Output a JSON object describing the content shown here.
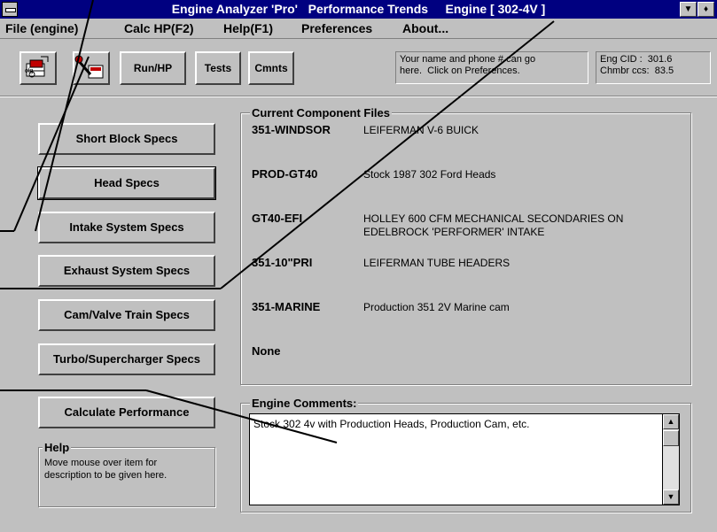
{
  "window": {
    "title": "Engine Analyzer 'Pro'   Performance Trends     Engine [ 302-4V ]",
    "system_menu_icon": "system-menu-dash",
    "minimize_glyph": "▼",
    "restore_glyph": "♦"
  },
  "menu": {
    "items": [
      "File (engine)",
      "Calc HP(F2)",
      "Help(F1)",
      "Preferences",
      "About..."
    ]
  },
  "toolbar": {
    "icon_buttons": [
      "engine-file-icon",
      "calc-wrench-icon"
    ],
    "run_label": "Run/HP",
    "tests_label": "Tests",
    "cmnts_label": "Cmnts",
    "info_text": "Your name and phone # can go\nhere.  Click on Preferences.",
    "engine_info": "Eng CID :  301.6\nChmbr ccs:  83.5"
  },
  "specs_buttons": [
    "Short Block Specs",
    "Head Specs",
    "Intake System Specs",
    "Exhaust System Specs",
    "Cam/Valve Train Specs",
    "Turbo/Supercharger Specs"
  ],
  "calculate_label": "Calculate Performance",
  "help": {
    "title": "Help",
    "text": "Move mouse over item for\ndescription to be given here."
  },
  "component_files": {
    "title": "Current Component Files",
    "rows": [
      {
        "name": "351-WINDSOR",
        "desc": "LEIFERMAN V-6 BUICK"
      },
      {
        "name": "PROD-GT40",
        "desc": "Stock 1987 302 Ford Heads"
      },
      {
        "name": "GT40-EFI",
        "desc": "HOLLEY 600 CFM MECHANICAL SECONDARIES ON EDELBROCK 'PERFORMER' INTAKE"
      },
      {
        "name": "351-10\"PRI",
        "desc": "LEIFERMAN TUBE HEADERS"
      },
      {
        "name": "351-MARINE",
        "desc": "Production 351 2V Marine cam"
      },
      {
        "name": "None",
        "desc": ""
      }
    ]
  },
  "engine_comments": {
    "title": "Engine Comments:",
    "text": "Stock 302 4v  with Production Heads, Production Cam, etc."
  },
  "colors": {
    "titlebar": "#000080",
    "face": "#c0c0c0",
    "callout_line": "#000000"
  }
}
